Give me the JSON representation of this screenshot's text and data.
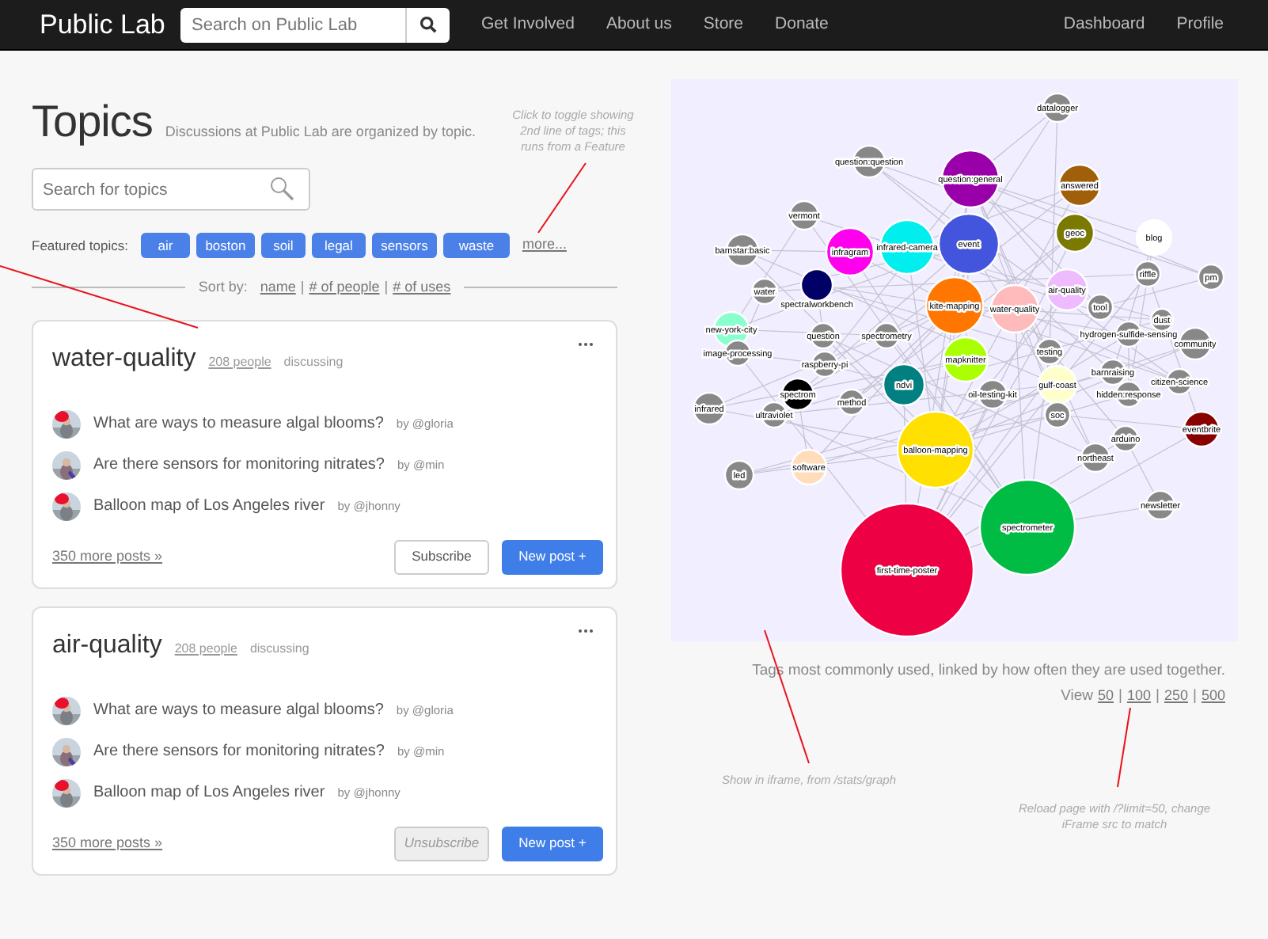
{
  "navbar": {
    "brand": "Public Lab",
    "search": {
      "placeholder": "Search on Public Lab"
    },
    "links": [
      "Get Involved",
      "About us",
      "Store",
      "Donate"
    ],
    "right_links": [
      "Dashboard",
      "Profile"
    ]
  },
  "header": {
    "title": "Topics",
    "subtitle": "Discussions at Public Lab are organized by topic."
  },
  "topic_search": {
    "placeholder": "Search for topics"
  },
  "featured": {
    "label": "Featured topics:",
    "tags": [
      "air",
      "boston",
      "soil",
      "legal",
      "sensors",
      "waste"
    ],
    "more": "more..."
  },
  "sort": {
    "label": "Sort by:",
    "separator": "|",
    "options": [
      "name",
      "# of people",
      "# of uses"
    ]
  },
  "topics": [
    {
      "name": "water-quality",
      "people": "208 people",
      "discussing": "discussing",
      "posts": [
        {
          "title": "What are ways to measure algal blooms?",
          "author": "by @gloria"
        },
        {
          "title": "Are there sensors for monitoring nitrates?",
          "author": "by @min"
        },
        {
          "title": "Balloon map of Los Angeles river",
          "author": "by @jhonny"
        }
      ],
      "more_posts": "350 more posts »",
      "subscribe": {
        "label": "Subscribe",
        "subscribed": false
      },
      "new_post": "New post +"
    },
    {
      "name": "air-quality",
      "people": "208 people",
      "discussing": "discussing",
      "posts": [
        {
          "title": "What are ways to measure algal blooms?",
          "author": "by @gloria"
        },
        {
          "title": "Are there sensors for monitoring nitrates?",
          "author": "by @min"
        },
        {
          "title": "Balloon map of Los Angeles river",
          "author": "by @jhonny"
        }
      ],
      "more_posts": "350 more posts »",
      "subscribe": {
        "label": "Unsubscribe",
        "subscribed": true
      },
      "new_post": "New post +"
    }
  ],
  "graph": {
    "nodes": [
      {
        "label": "datalogger",
        "color": "#888888"
      },
      {
        "label": "question:question",
        "color": "#888888"
      },
      {
        "label": "question:general",
        "color": "#9900aa"
      },
      {
        "label": "answered",
        "color": "#a0600a"
      },
      {
        "label": "vermont",
        "color": "#888888"
      },
      {
        "label": "geoc",
        "color": "#7a7a00"
      },
      {
        "label": "blog",
        "color": "#ffffff"
      },
      {
        "label": "event",
        "color": "#4455dd"
      },
      {
        "label": "infragram",
        "color": "#ff00ee"
      },
      {
        "label": "infrared-camera",
        "color": "#00eeee"
      },
      {
        "label": "barnstar:basic",
        "color": "#888888"
      },
      {
        "label": "riffle",
        "color": "#888888"
      },
      {
        "label": "pm",
        "color": "#888888"
      },
      {
        "label": "water",
        "color": "#888888"
      },
      {
        "label": "spectralworkbench",
        "color": "#000066"
      },
      {
        "label": "kite-mapping",
        "color": "#ff7700"
      },
      {
        "label": "water-quality",
        "color": "#ffbbbb"
      },
      {
        "label": "air-quality",
        "color": "#eebbff"
      },
      {
        "label": "tool",
        "color": "#888888"
      },
      {
        "label": "new-york-city",
        "color": "#88ffcc"
      },
      {
        "label": "dust",
        "color": "#888888"
      },
      {
        "label": "question",
        "color": "#888888"
      },
      {
        "label": "spectrometry",
        "color": "#888888"
      },
      {
        "label": "image-processing",
        "color": "#888888"
      },
      {
        "label": "raspberry-pi",
        "color": "#888888"
      },
      {
        "label": "mapknitter",
        "color": "#aaff00"
      },
      {
        "label": "hydrogen-sulfide-sensing",
        "color": "#888888"
      },
      {
        "label": "community",
        "color": "#888888"
      },
      {
        "label": "testing",
        "color": "#888888"
      },
      {
        "label": "ndvi",
        "color": "#008080"
      },
      {
        "label": "gulf-coast",
        "color": "#ffffcc"
      },
      {
        "label": "spectrom",
        "color": "#000000"
      },
      {
        "label": "method",
        "color": "#888888"
      },
      {
        "label": "infrared",
        "color": "#888888"
      },
      {
        "label": "ultraviolet",
        "color": "#888888"
      },
      {
        "label": "oil-testing-kit",
        "color": "#888888"
      },
      {
        "label": "soc",
        "color": "#888888"
      },
      {
        "label": "barnraising",
        "color": "#888888"
      },
      {
        "label": "citizen-science",
        "color": "#888888"
      },
      {
        "label": "hidden:response",
        "color": "#888888"
      },
      {
        "label": "eventbrite",
        "color": "#880000"
      },
      {
        "label": "arduino",
        "color": "#888888"
      },
      {
        "label": "northeast",
        "color": "#888888"
      },
      {
        "label": "balloon-mapping",
        "color": "#ffe000"
      },
      {
        "label": "software",
        "color": "#ffddbb"
      },
      {
        "label": "led",
        "color": "#888888"
      },
      {
        "label": "newsletter",
        "color": "#888888"
      },
      {
        "label": "spectrometer",
        "color": "#00bb44"
      },
      {
        "label": "first-time-poster",
        "color": "#ee0044"
      }
    ],
    "caption": "Tags most commonly used, linked by how often they are used together.",
    "view_label": "View",
    "separator": "|",
    "view_options": [
      "50",
      "100",
      "250",
      "500"
    ]
  },
  "annotations": [
    "Click to toggle showing 2nd line of tags; this runs from a Feature",
    "Show in iframe, from /stats/graph",
    "Reload page with /?limit=50, change iFrame src to match"
  ]
}
